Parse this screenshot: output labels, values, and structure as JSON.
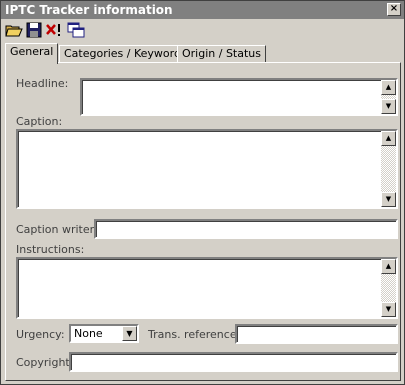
{
  "window": {
    "title": "IPTC Tracker information",
    "close_label": "×"
  },
  "toolbar": {
    "icons": [
      "open-folder-icon",
      "save-icon",
      "delete-icon",
      "copy-to-clipboard-icon"
    ]
  },
  "tabs": [
    {
      "label": "General",
      "active": true
    },
    {
      "label": "Categories / Keywords",
      "active": false
    },
    {
      "label": "Origin / Status",
      "active": false
    }
  ],
  "form": {
    "headline_label": "Headline:",
    "headline_value": "",
    "caption_label": "Caption:",
    "caption_value": "",
    "caption_writer_label": "Caption writer:",
    "caption_writer_value": "",
    "instructions_label": "Instructions:",
    "instructions_value": "",
    "urgency_label": "Urgency:",
    "urgency_value": "None",
    "trans_reference_label": "Trans. reference:",
    "trans_reference_value": "",
    "copyright_label": "Copyright:",
    "copyright_value": ""
  },
  "colors": {
    "titlebar": "#808080",
    "face": "#d4d0c8"
  }
}
